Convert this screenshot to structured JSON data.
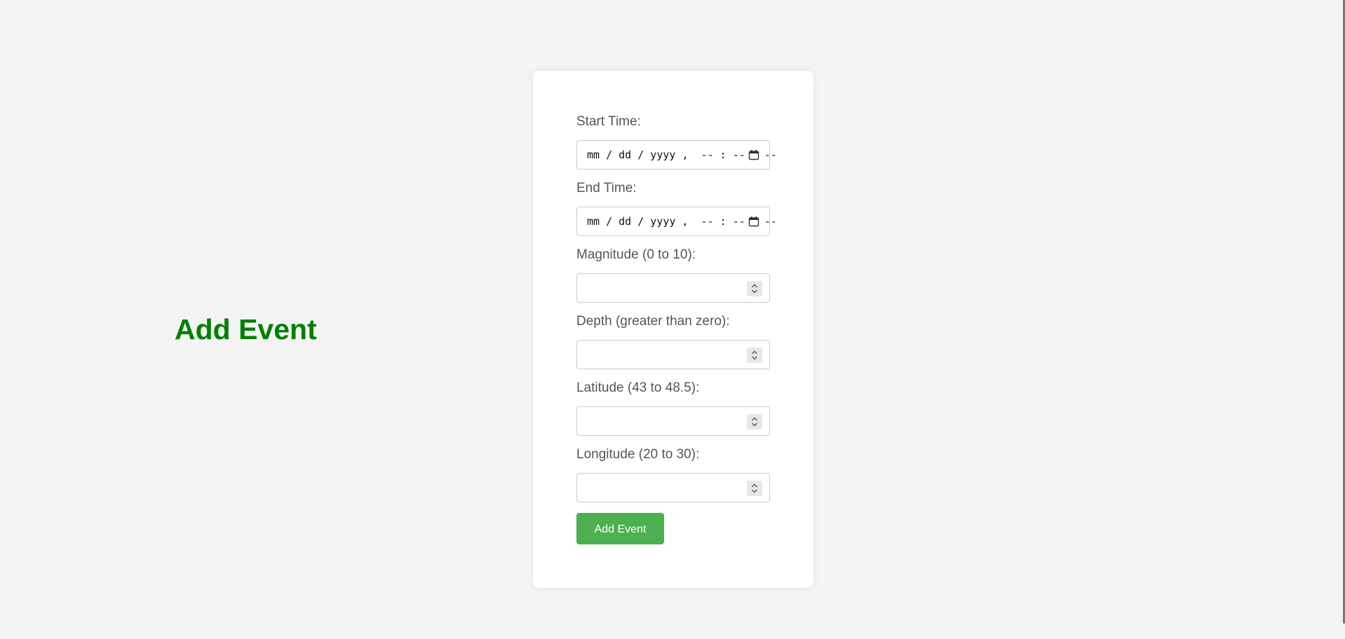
{
  "page": {
    "title": "Add Event",
    "title_color": "#008000"
  },
  "form": {
    "fields": [
      {
        "label": "Start Time:",
        "type": "datetime-local",
        "placeholder": "mm / dd / yyyy ,  -- : --   --",
        "value": ""
      },
      {
        "label": "End Time:",
        "type": "datetime-local",
        "placeholder": "mm / dd / yyyy ,  -- : --   --",
        "value": ""
      },
      {
        "label": "Magnitude (0 to 10):",
        "type": "number",
        "value": ""
      },
      {
        "label": "Depth (greater than zero):",
        "type": "number",
        "value": ""
      },
      {
        "label": "Latitude (43 to 48.5):",
        "type": "number",
        "value": ""
      },
      {
        "label": "Longitude (20 to 30):",
        "type": "number",
        "value": ""
      }
    ],
    "submit_label": "Add Event",
    "submit_color": "#4caf50"
  },
  "icons": {
    "datetime": "calendar-icon",
    "number": "spinner-icon"
  }
}
